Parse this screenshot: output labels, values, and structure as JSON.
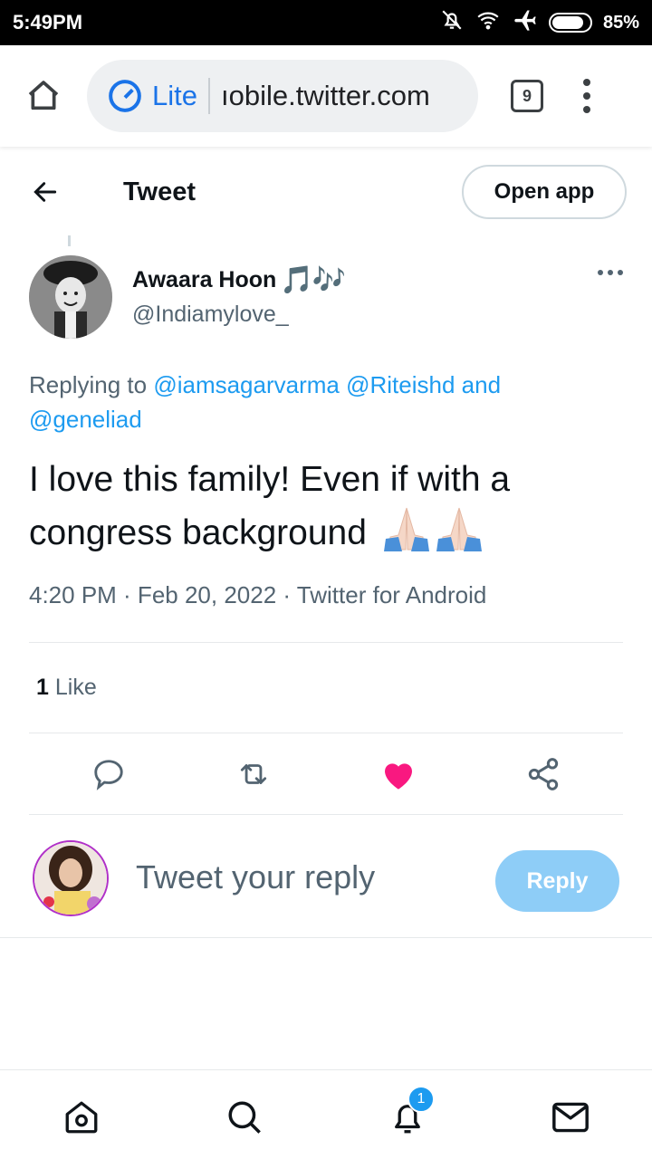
{
  "status_bar": {
    "time": "5:49PM",
    "battery": "85%",
    "battery_level": 0.85,
    "icons": [
      "bell-off-icon",
      "wifi-icon",
      "airplane-icon",
      "battery-icon"
    ]
  },
  "browser": {
    "mode_label": "Lite",
    "url": "ıobile.twitter.com",
    "tab_count": "9"
  },
  "header": {
    "title": "Tweet",
    "open_app_label": "Open app"
  },
  "tweet": {
    "author_name": "Awaara Hoon",
    "author_emoji": "🎵🎶",
    "handle": "@Indiamylove_",
    "replying_prefix": "Replying to ",
    "mention_1": "@iamsagarvarma",
    "mention_2": "@Riteishd",
    "mention_and": "and",
    "mention_3": "@geneliad",
    "text": "I love this family! Even if with a congress background",
    "timestamp": "4:20 PM · Feb 20, 2022 · Twitter for Android",
    "like_count": "1",
    "like_label": "Like",
    "liked": true
  },
  "composer": {
    "placeholder": "Tweet your reply",
    "reply_label": "Reply"
  },
  "bottom_nav": {
    "items": [
      "home-icon",
      "search-icon",
      "notifications-icon",
      "messages-icon"
    ],
    "notification_badge": "1"
  },
  "colors": {
    "accent": "#1d9bf0",
    "like": "#f91880",
    "reply_button": "#8ecdf7",
    "secondary_text": "#536471"
  }
}
